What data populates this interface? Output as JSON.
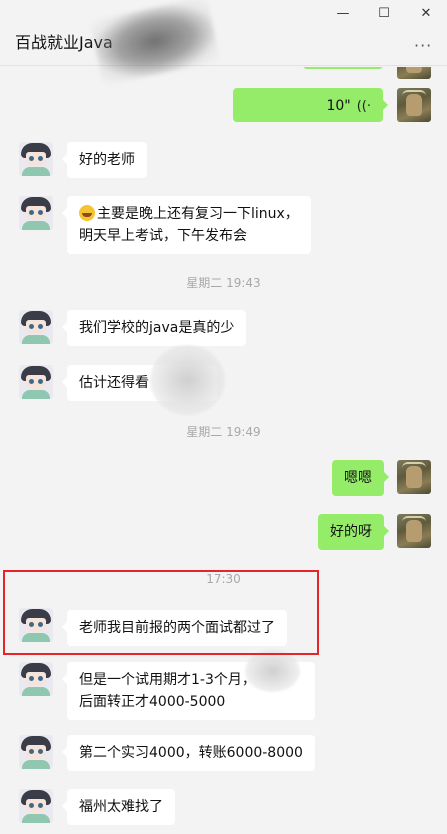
{
  "window": {
    "title": "百战就业Java",
    "controls": {
      "minimize": "—",
      "maximize": "☐",
      "close": "✕"
    },
    "more": "···"
  },
  "messages": [
    {
      "side": "out",
      "type": "voice",
      "text": "10\"",
      "icon": "voice-wave-icon"
    },
    {
      "side": "in",
      "text": "好的老师"
    },
    {
      "side": "in",
      "emoji": "laughing-tears-emoji",
      "line1": "主要是晚上还有复习一下linux，",
      "line2": "明天早上考试，下午发布会"
    },
    {
      "type": "time",
      "text": "星期二 19:43"
    },
    {
      "side": "in",
      "text": "我们学校的java是真的少"
    },
    {
      "side": "in",
      "text": "估计还得看"
    },
    {
      "type": "time",
      "text": "星期二 19:49"
    },
    {
      "side": "out",
      "text": "嗯嗯"
    },
    {
      "side": "out",
      "text": "好的呀"
    },
    {
      "type": "time",
      "text": "17:30"
    },
    {
      "side": "in",
      "text": "老师我目前报的两个面试都过了",
      "highlighted": true
    },
    {
      "side": "in",
      "line1": "但是一个试用期才1-3个月，",
      "line2": "后面转正才4000-5000"
    },
    {
      "side": "in",
      "text": "第二个实习4000，转账6000-8000"
    },
    {
      "side": "in",
      "text": "福州太难找了"
    }
  ],
  "colors": {
    "background": "#f3f3f3",
    "incoming_bubble": "#ffffff",
    "outgoing_bubble": "#95ec69",
    "highlight_box": "#e8232a",
    "timestamp": "#a8a8a8"
  }
}
